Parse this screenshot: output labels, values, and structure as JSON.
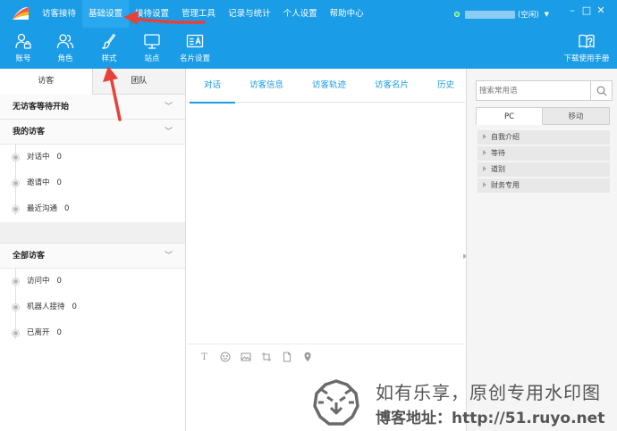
{
  "menu": {
    "items": [
      "访客接待",
      "基础设置",
      "接待设置",
      "管理工具",
      "记录与统计",
      "个人设置",
      "帮助中心"
    ],
    "active_index": 1
  },
  "status": {
    "state": "(空闲)"
  },
  "toolbar": {
    "items": [
      {
        "label": "账号",
        "icon": "account-lock-icon"
      },
      {
        "label": "角色",
        "icon": "role-users-icon"
      },
      {
        "label": "样式",
        "icon": "brush-icon"
      },
      {
        "label": "站点",
        "icon": "monitor-icon"
      },
      {
        "label": "名片设置",
        "icon": "card-icon"
      }
    ],
    "manual_label": "下载使用手册"
  },
  "left_panel": {
    "tabs": [
      "访客",
      "团队"
    ],
    "sections": {
      "waiting": {
        "title": "无访客等待开始"
      },
      "my_visitors": {
        "title": "我的访客",
        "items": [
          {
            "label": "对话中",
            "count": "0"
          },
          {
            "label": "邀请中",
            "count": "0"
          },
          {
            "label": "最近沟通",
            "count": "0"
          }
        ]
      },
      "all_visitors": {
        "title": "全部访客",
        "items": [
          {
            "label": "访问中",
            "count": "0"
          },
          {
            "label": "机器人接待",
            "count": "0"
          },
          {
            "label": "已离开",
            "count": "0"
          }
        ]
      }
    }
  },
  "center": {
    "tabs": [
      "对话",
      "访客信息",
      "访客轨迹",
      "访客名片",
      "历史"
    ]
  },
  "right_panel": {
    "search_placeholder": "搜索常用语",
    "tabs": [
      "PC",
      "移动"
    ],
    "phrases": [
      "自我介绍",
      "等待",
      "道别",
      "财务专用"
    ]
  },
  "watermark": {
    "line1": "如有乐享，原创专用水印图",
    "line2": "博客地址：http://51.ruyo.net"
  },
  "colors": {
    "brand": "#1a9ce6",
    "arrow": "#e8413a"
  }
}
